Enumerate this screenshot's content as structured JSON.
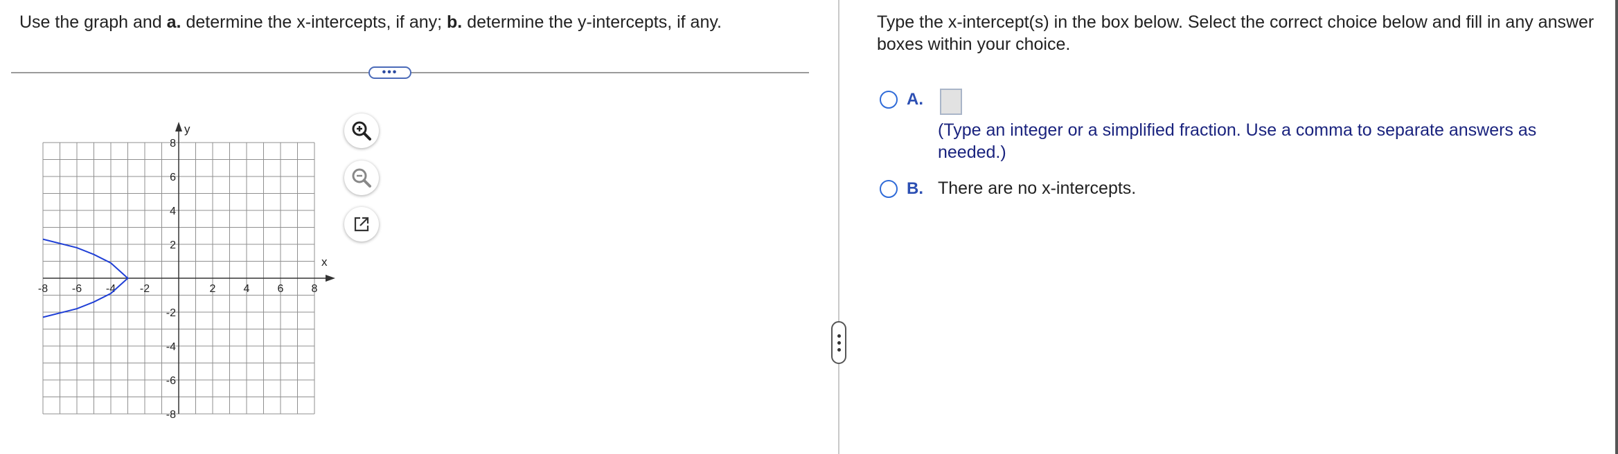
{
  "question": {
    "intro": "Use the graph and ",
    "part_a_label": "a.",
    "part_a_text": " determine the x-intercepts, if any; ",
    "part_b_label": "b.",
    "part_b_text": " determine the y-intercepts, if any."
  },
  "divider_button": "•••",
  "graph": {
    "x_axis_label": "x",
    "y_axis_label": "y",
    "x_tick_labels": [
      "-8",
      "-6",
      "-4",
      "-2",
      "2",
      "4",
      "6",
      "8"
    ],
    "y_tick_labels": [
      "8",
      "6",
      "4",
      "2",
      "-2",
      "-4",
      "-6",
      "-8"
    ],
    "x_range": [
      -8,
      8
    ],
    "y_range": [
      -8,
      8
    ],
    "grid": true,
    "curve_color": "#1f3fd6",
    "curve": {
      "type": "sideways-parabola",
      "vertex": [
        -3,
        0
      ],
      "points": [
        [
          -8,
          2.3
        ],
        [
          -6,
          1.8
        ],
        [
          -5,
          1.4
        ],
        [
          -4,
          0.9
        ],
        [
          -3,
          0
        ],
        [
          -4,
          -0.9
        ],
        [
          -5,
          -1.4
        ],
        [
          -6,
          -1.8
        ],
        [
          -8,
          -2.3
        ]
      ]
    }
  },
  "tools": {
    "zoom_in": "zoom-in-icon",
    "zoom_out": "zoom-out-icon",
    "popout": "external-link-icon"
  },
  "panel": {
    "instruction": "Type the x-intercept(s) in the box below. Select the correct choice below and fill in any answer boxes within your choice.",
    "choice_a_letter": "A.",
    "choice_a_hint": "(Type an integer or a simplified fraction. Use a comma to separate answers as needed.)",
    "choice_a_value": "",
    "choice_b_letter": "B.",
    "choice_b_text": "There are no x-intercepts."
  },
  "colors": {
    "accent": "#2f6bd8",
    "hint_text": "#1a237e"
  }
}
